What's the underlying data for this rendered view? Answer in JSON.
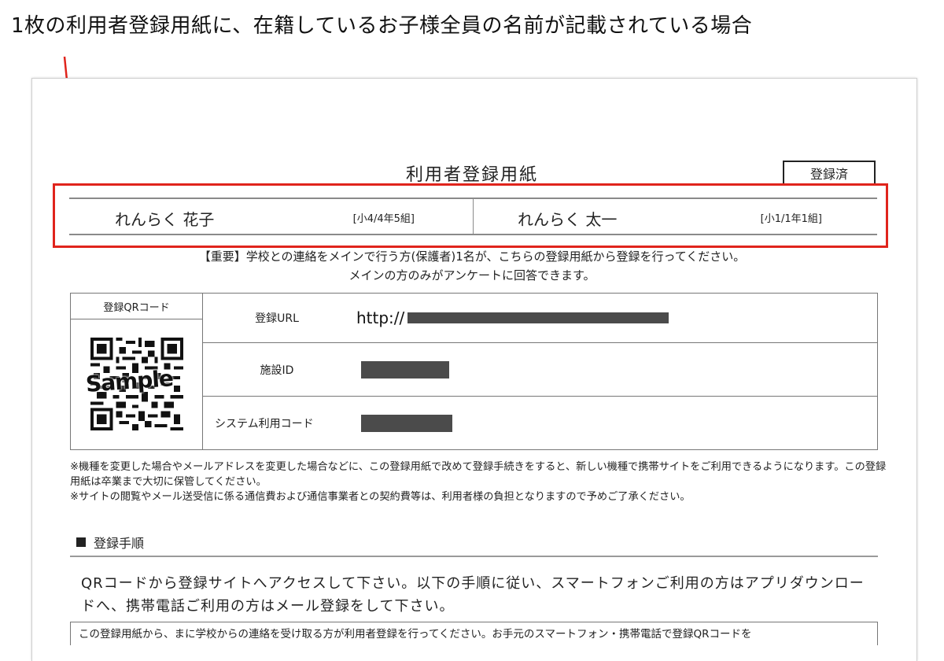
{
  "caption": "1枚の利用者登録用紙に、在籍しているお子様全員の名前が記載されている場合",
  "form": {
    "title": "利用者登録用紙",
    "stamp": "登録済",
    "children": [
      {
        "name": "れんらく 花子",
        "class": "[小4/4年5組]"
      },
      {
        "name": "れんらく 太一",
        "class": "[小1/1年1組]"
      }
    ],
    "notice_line1": "【重要】学校との連絡をメインで行う方(保護者)1名が、こちらの登録用紙から登録を行ってください。",
    "notice_line2": "メインの方のみがアンケートに回答できます。",
    "qr_label": "登録QRコード",
    "qr_overlay": "Sample",
    "rows": [
      {
        "label": "登録URL",
        "value_prefix": "http://"
      },
      {
        "label": "施設ID"
      },
      {
        "label": "システム利用コード"
      }
    ],
    "note1": "※機種を変更した場合やメールアドレスを変更した場合などに、この登録用紙で改めて登録手続きをすると、新しい機種で携帯サイトをご利用できるようになります。この登録用紙は卒業まで大切に保管してください。",
    "note2": "※サイトの閲覧やメール送受信に係る通信費および通信事業者との契約費等は、利用者様の負担となりますので予めご了承ください。",
    "section_title": "登録手順",
    "steps_intro": "QRコードから登録サイトへアクセスして下さい。以下の手順に従い、スマートフォンご利用の方はアプリダウンロードへ、携帯電話ご利用の方はメール登録をして下さい。",
    "cut_text": "この登録用紙から、まに学校からの連絡を受け取る方が利用者登録を行ってください。お手元のスマートフォン・携帯電話で登録QRコードを"
  },
  "colors": {
    "highlight": "#e0241c",
    "redaction": "#4b4b4b"
  }
}
